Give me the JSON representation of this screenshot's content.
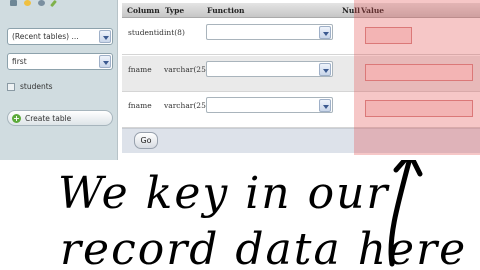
{
  "sidebar": {
    "icons": [
      "home-icon",
      "lightbulb-icon",
      "info-icon",
      "pencil-icon"
    ],
    "recent_tables": "(Recent tables) ...",
    "database": "first",
    "table_name": "students",
    "create_table_label": "Create table"
  },
  "form": {
    "headers": {
      "column": "Column",
      "type": "Type",
      "function": "Function",
      "null": "Null",
      "value": "Value"
    },
    "rows": [
      {
        "column": "studentid",
        "type": "int(8)",
        "function": "",
        "value": ""
      },
      {
        "column": "fname",
        "type": "varchar(25)",
        "function": "",
        "value": ""
      },
      {
        "column": "fname",
        "type": "varchar(25)",
        "function": "",
        "value": ""
      }
    ],
    "go_label": "Go"
  },
  "annotation": {
    "line1": "We key in our",
    "line2": "record data here"
  },
  "colors": {
    "highlight": "#e25050",
    "nav_bg": "#d0dce0"
  }
}
